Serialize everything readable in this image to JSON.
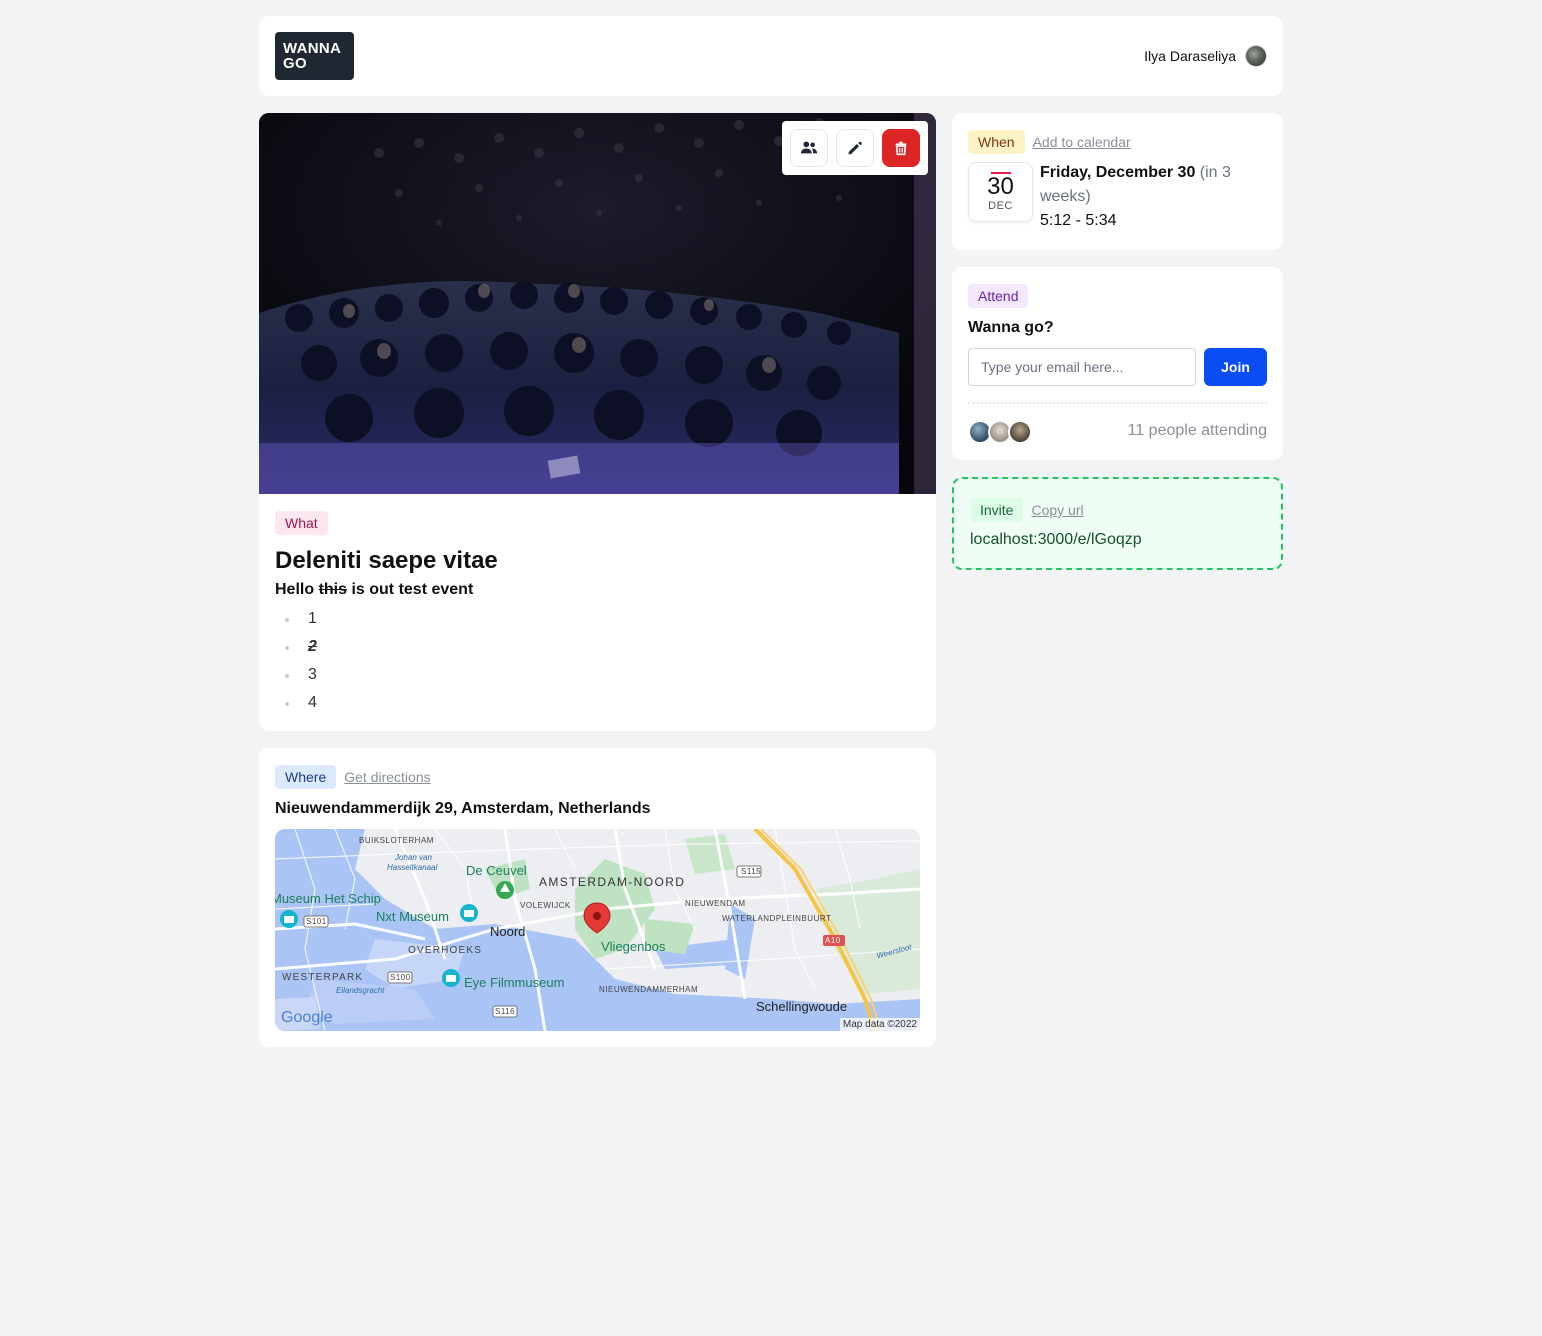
{
  "header": {
    "logo_line1": "WANNA",
    "logo_line2": "GO",
    "user_name": "Ilya Daraseliya"
  },
  "event_actions": {
    "attendees_icon": "users-icon",
    "edit_icon": "pencil-icon",
    "delete_icon": "trash-icon",
    "delete_color": "#dc2626"
  },
  "what": {
    "tag": "What",
    "title": "Deleniti saepe vitae",
    "description_before": "Hello ",
    "description_struck": "this",
    "description_after": " is out test event",
    "list_items": [
      "1",
      "2",
      "3",
      "4"
    ]
  },
  "where": {
    "tag": "Where",
    "directions_link": "Get directions",
    "address": "Nieuwendammerdijk 29, Amsterdam, Netherlands",
    "map": {
      "labels": {
        "buiksloterham": "BUIKSLOTERHAM",
        "johan": "Johan van",
        "hasselt": "Hasseltkanaal",
        "de_ceuvel": "De Ceuvel",
        "amsterdam_noord": "AMSTERDAM-NOORD",
        "museum_het_schip": "Museum Het Schip",
        "nxt_museum": "Nxt Museum",
        "volewijck": "VOLEWIJCK",
        "noord": "Noord",
        "nieuwendam": "NIEUWENDAM",
        "waterlandpleinbuurt": "WATERLANDPLEINBUURT",
        "vliegenbos": "Vliegenbos",
        "overhoeks": "OVERHOEKS",
        "westerpark": "WESTERPARK",
        "eilandsgracht": "Eilandsgracht",
        "eye": "Eye Filmmuseum",
        "nieuwendammerham": "NIEUWENDAMMERHAM",
        "schellingwoude": "Schellingwoude",
        "weersloot": "Weersloot",
        "s115": "S115",
        "s101": "S101",
        "s100": "S100",
        "s116": "S116",
        "a10": "A10",
        "google": "Google",
        "map_data": "Map data ©2022"
      },
      "water_color": "#aac4f6",
      "park_color": "#bfe3c2",
      "marker_color": "#e53935"
    }
  },
  "when": {
    "tag": "When",
    "calendar_link": "Add to calendar",
    "day": "30",
    "month": "DEC",
    "date": "Friday, December 30",
    "relative": " (in 3 weeks)",
    "time": "5:12 - 5:34"
  },
  "attend": {
    "tag": "Attend",
    "question": "Wanna go?",
    "email_placeholder": "Type your email here...",
    "join_label": "Join",
    "attending_text": "11 people attending",
    "join_color": "#0b4df5"
  },
  "invite": {
    "tag": "Invite",
    "copy_link": "Copy url",
    "url": "localhost:3000/e/lGoqzp"
  }
}
